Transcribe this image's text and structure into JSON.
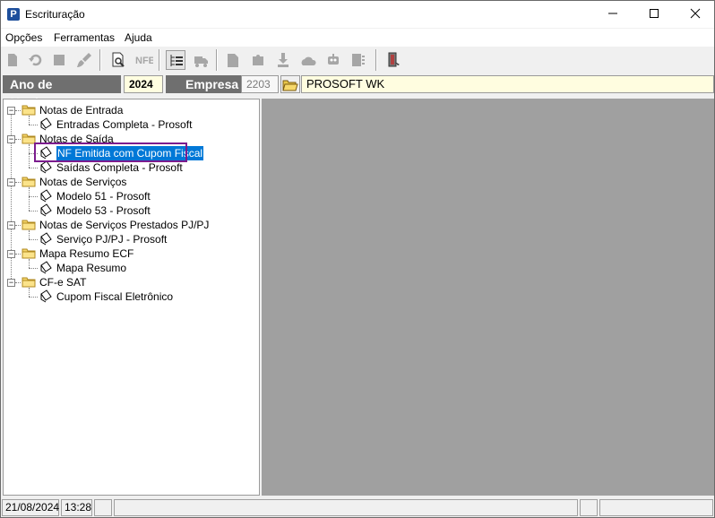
{
  "window": {
    "title": "Escrituração"
  },
  "menu": [
    "Opções",
    "Ferramentas",
    "Ajuda"
  ],
  "toolbar": {
    "icons": [
      "new-icon",
      "undo-icon",
      "stop-icon",
      "brush-icon",
      "preview-icon",
      "nfe-icon",
      "tree-icon",
      "truck-icon",
      "file-icon",
      "puzzle-icon",
      "import-icon",
      "cloud-icon",
      "robot-icon",
      "list-icon",
      "exit-icon"
    ],
    "nfe_label": "NFE"
  },
  "header": {
    "ano_label": "Ano de Movimento",
    "ano_value": "2024",
    "empresa_label": "Empresa",
    "empresa_code": "2203",
    "empresa_name": "PROSOFT WK"
  },
  "tree": [
    {
      "label": "Notas de Entrada",
      "children": [
        "Entradas Completa - Prosoft"
      ]
    },
    {
      "label": "Notas de Saída",
      "children": [
        "NF Emitida com Cupom Fiscal",
        "Saídas Completa - Prosoft"
      ]
    },
    {
      "label": "Notas de Serviços",
      "children": [
        "Modelo 51 - Prosoft",
        "Modelo 53 - Prosoft"
      ]
    },
    {
      "label": "Notas de Serviços Prestados PJ/PJ",
      "children": [
        "Serviço PJ/PJ - Prosoft"
      ]
    },
    {
      "label": "Mapa Resumo ECF",
      "children": [
        "Mapa Resumo"
      ]
    },
    {
      "label": "CF-e SAT",
      "children": [
        "Cupom Fiscal Eletrônico"
      ]
    }
  ],
  "selected_item": "NF Emitida com Cupom Fiscal",
  "status": {
    "date": "21/08/2024",
    "time": "13:28"
  },
  "colors": {
    "selection": "#0078d7",
    "highlight_box": "#7b1c8e",
    "header_label_bg": "#6f6f6f",
    "empresa_field_bg": "#fffde0"
  }
}
